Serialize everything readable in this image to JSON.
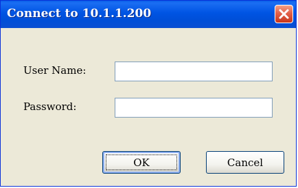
{
  "window": {
    "title": "Connect to 10.1.1.200",
    "close_icon": "close-icon"
  },
  "form": {
    "username_label": "User Name:",
    "username_value": "",
    "password_label": "Password:",
    "password_value": ""
  },
  "buttons": {
    "ok_label": "OK",
    "cancel_label": "Cancel"
  },
  "colors": {
    "titlebar": "#0054e3",
    "close_button": "#e2614a",
    "dialog_background": "#ece9d8"
  }
}
